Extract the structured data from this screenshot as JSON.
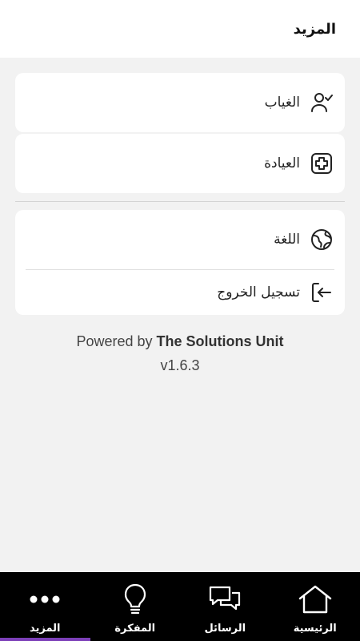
{
  "header": {
    "title": "المزيد"
  },
  "menu": {
    "absence": {
      "label": "الغياب",
      "icon": "user-check-icon"
    },
    "clinic": {
      "label": "العيادة",
      "icon": "medical-plus-icon"
    },
    "language": {
      "label": "اللغة",
      "icon": "globe-icon"
    },
    "logout": {
      "label": "تسجيل الخروج",
      "icon": "logout-icon"
    }
  },
  "footer": {
    "powered_prefix": "Powered by",
    "powered_brand": "The Solutions Unit",
    "version": "v1.6.3"
  },
  "tabs": [
    {
      "label": "المزيد",
      "icon": "more-dots-icon",
      "active": true
    },
    {
      "label": "المفكرة",
      "icon": "lightbulb-icon",
      "active": false
    },
    {
      "label": "الرسائل",
      "icon": "chat-bubbles-icon",
      "active": false
    },
    {
      "label": "الرئيسية",
      "icon": "home-icon",
      "active": false
    }
  ],
  "colors": {
    "accent": "#7c3fb8",
    "tabbar": "#000000",
    "background": "#f2f2f2"
  }
}
